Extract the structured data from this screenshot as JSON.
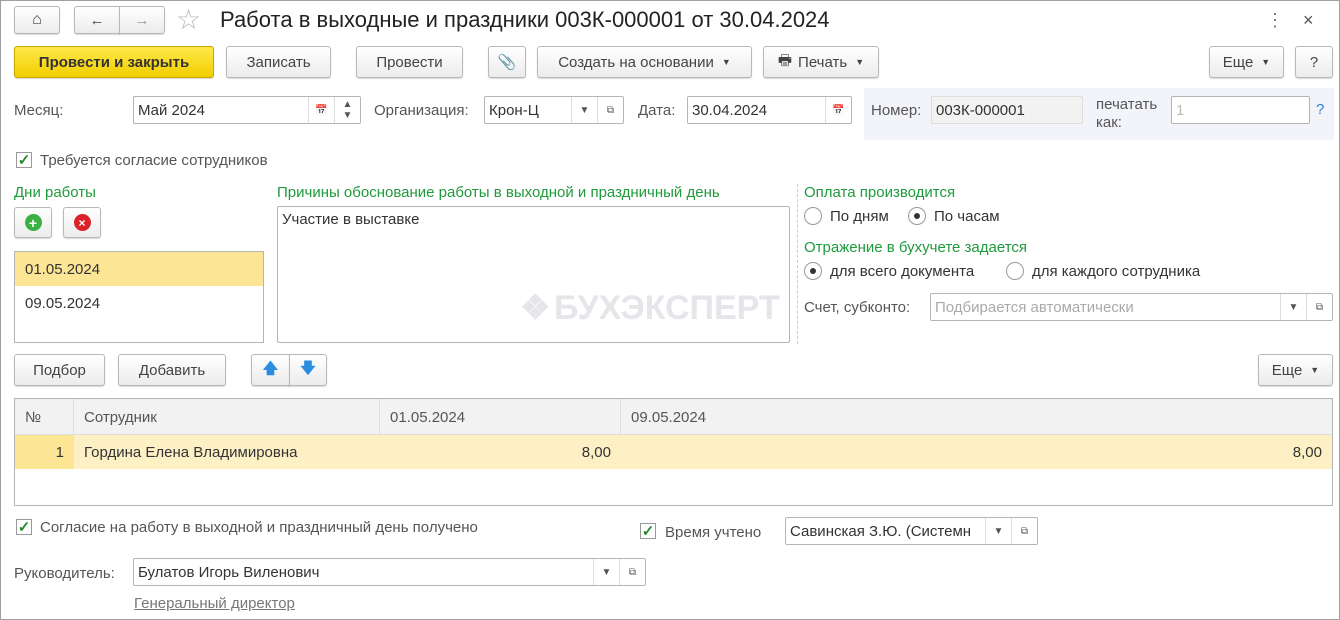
{
  "title": "Работа в выходные и праздники 003К-000001 от 30.04.2024",
  "toolbar": {
    "post_close": "Провести и закрыть",
    "save": "Записать",
    "post": "Провести",
    "create_based": "Создать на основании",
    "print": "Печать",
    "more": "Еще",
    "help": "?"
  },
  "fields": {
    "month_label": "Месяц:",
    "month": "Май 2024",
    "org_label": "Организация:",
    "org": "Крон-Ц",
    "date_label": "Дата:",
    "date": "30.04.2024",
    "number_label": "Номер:",
    "number": "003К-000001",
    "print_as_label": "печатать как:",
    "print_as": "1",
    "help": "?"
  },
  "consent_required": {
    "label": "Требуется согласие сотрудников",
    "checked": true
  },
  "work_days": {
    "title": "Дни работы",
    "items": [
      "01.05.2024",
      "09.05.2024"
    ]
  },
  "reasons": {
    "title": "Причины обоснование работы в выходной и праздничный день",
    "text": "Участие в выставке"
  },
  "payment": {
    "title": "Оплата производится",
    "by_days": "По дням",
    "by_hours": "По часам",
    "selected": "by_hours"
  },
  "accounting": {
    "title": "Отражение в бухучете задается",
    "whole": "для всего документа",
    "each": "для каждого сотрудника",
    "selected": "whole",
    "account_label": "Счет, субконто:",
    "account_placeholder": "Подбирается автоматически"
  },
  "table_toolbar": {
    "pick": "Подбор",
    "add": "Добавить",
    "more": "Еще"
  },
  "table": {
    "headers": [
      "№",
      "Сотрудник",
      "01.05.2024",
      "09.05.2024"
    ],
    "rows": [
      [
        "1",
        "Гордина Елена Владимировна",
        "8,00",
        "8,00"
      ]
    ]
  },
  "consent_received": {
    "label": "Согласие на работу в выходной и праздничный день получено",
    "checked": true
  },
  "time_counted": {
    "label": "Время учтено",
    "checked": true,
    "value": "Савинская З.Ю. (Системн"
  },
  "manager": {
    "label": "Руководитель:",
    "value": "Булатов Игорь Виленович",
    "position": "Генеральный директор"
  },
  "watermark": "БУХЭКСПЕРТ"
}
